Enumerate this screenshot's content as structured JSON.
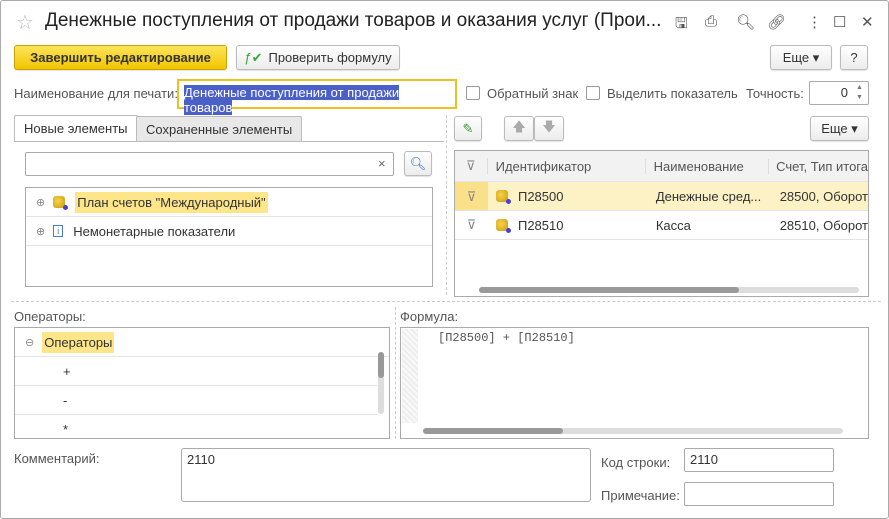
{
  "window": {
    "title": "Денежные поступления от продажи товаров и оказания услуг (Прои...",
    "icons": [
      "save-icon",
      "print-icon",
      "preview-icon",
      "link-icon",
      "more-vert-icon",
      "maximize-icon",
      "close-icon"
    ]
  },
  "toolbar": {
    "finish_label": "Завершить редактирование",
    "check_label": "Проверить формулу",
    "more_label": "Еще ▾",
    "help_label": "?"
  },
  "print_name": {
    "label": "Наименование для печати:",
    "value": "Денежные поступления от продажи товаров"
  },
  "reverse_sign": {
    "label": "Обратный знак",
    "checked": false
  },
  "highlight": {
    "label": "Выделить показатель",
    "checked": false
  },
  "precision": {
    "label": "Точность:",
    "value": "0"
  },
  "tabs": [
    {
      "label": "Новые элементы",
      "active": true
    },
    {
      "label": "Сохраненные элементы",
      "active": false
    }
  ],
  "search": {
    "value": "",
    "clear": "×"
  },
  "tree": [
    {
      "label": "План счетов \"Международный\"",
      "selected": true
    },
    {
      "label": "Немонетарные показатели",
      "selected": false
    }
  ],
  "grid": {
    "more_label": "Еще ▾",
    "columns": [
      "Идентификатор",
      "Наименование",
      "Счет, Тип итога"
    ],
    "rows": [
      {
        "id": "П28500",
        "name": "Денежные сред...",
        "account": "28500, Оборот",
        "selected": true
      },
      {
        "id": "П28510",
        "name": "Касса",
        "account": "28510, Оборот",
        "selected": false
      }
    ]
  },
  "operators": {
    "label": "Операторы:",
    "group": "Операторы",
    "items": [
      "+",
      "-",
      "*"
    ]
  },
  "formula": {
    "label": "Формула:",
    "text": "[П28500] + [П28510]"
  },
  "comment": {
    "label": "Комментарий:",
    "value": "2110"
  },
  "line_code": {
    "label": "Код строки:",
    "value": "2110"
  },
  "note": {
    "label": "Примечание:",
    "value": ""
  }
}
